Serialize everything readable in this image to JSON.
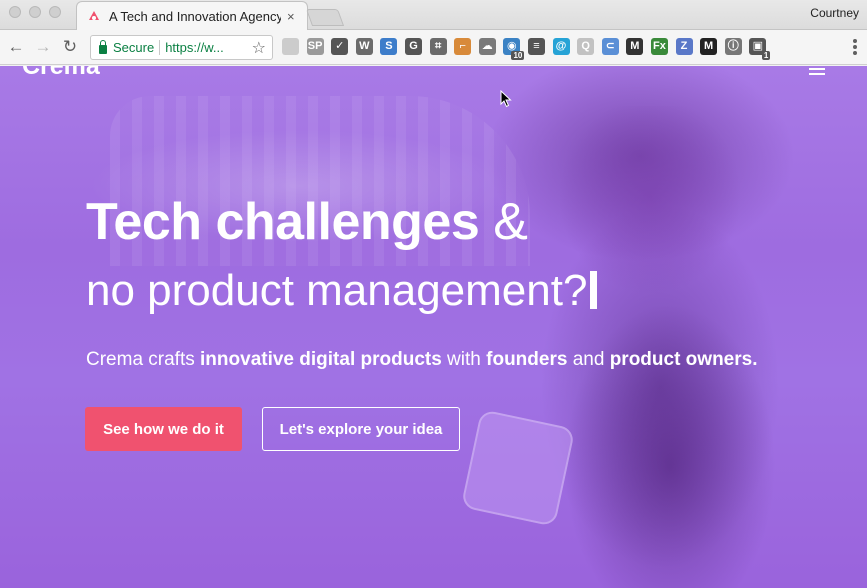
{
  "browser": {
    "tab_title": "A Tech and Innovation Agency",
    "tab_close": "×",
    "profile_name": "Courtney",
    "secure_label": "Secure",
    "url_visible": "https://w...",
    "star_icon": "☆",
    "back_icon": "←",
    "forward_icon": "→",
    "reload_icon": "↻",
    "extensions": [
      {
        "name": "hook-extension-icon",
        "glyph": "",
        "color": "#cccccc"
      },
      {
        "name": "sp-extension-icon",
        "glyph": "SP",
        "color": "#9a9a9a"
      },
      {
        "name": "checkmark-extension-icon",
        "glyph": "✓",
        "color": "#555555"
      },
      {
        "name": "wordpress-extension-icon",
        "glyph": "W",
        "color": "#6b6b6b"
      },
      {
        "name": "s-extension-icon",
        "glyph": "S",
        "color": "#3d7dca"
      },
      {
        "name": "g-extension-icon",
        "glyph": "G",
        "color": "#555555"
      },
      {
        "name": "crop-extension-icon",
        "glyph": "⌗",
        "color": "#6b6b6b"
      },
      {
        "name": "ruler-extension-icon",
        "glyph": "⌐",
        "color": "#d88a3a"
      },
      {
        "name": "cloud-extension-icon",
        "glyph": "☁",
        "color": "#7a7a7a"
      },
      {
        "name": "notification-extension-icon",
        "glyph": "◉",
        "color": "#3b82c4",
        "badge": "10"
      },
      {
        "name": "list-extension-icon",
        "glyph": "≡",
        "color": "#555555"
      },
      {
        "name": "at-extension-icon",
        "glyph": "@",
        "color": "#26a3d6"
      },
      {
        "name": "search-extension-icon",
        "glyph": "Q",
        "color": "#c2c2c2"
      },
      {
        "name": "rss-extension-icon",
        "glyph": "⊂",
        "color": "#5a8fd6"
      },
      {
        "name": "medium-extension-icon",
        "glyph": "M",
        "color": "#333333"
      },
      {
        "name": "fx-extension-icon",
        "glyph": "Fx",
        "color": "#3a8a3a"
      },
      {
        "name": "z-extension-icon",
        "glyph": "Z",
        "color": "#5a78c8"
      },
      {
        "name": "m-extension-icon",
        "glyph": "M",
        "color": "#222222"
      },
      {
        "name": "info-extension-icon",
        "glyph": "ⓘ",
        "color": "#777777"
      },
      {
        "name": "camera-extension-icon",
        "glyph": "▣",
        "color": "#555555",
        "badge": "1"
      }
    ]
  },
  "site": {
    "logo": "Crema",
    "headline_bold": "Tech challenges",
    "headline_amp": " &",
    "headline_line2": "no product management?",
    "tagline_1": "Crema crafts ",
    "tagline_2": "innovative digital products",
    "tagline_3": " with ",
    "tagline_4": "founders",
    "tagline_5": " and ",
    "tagline_6": "product owners.",
    "cta_primary": "See how we do it",
    "cta_secondary": "Let's explore your idea"
  },
  "colors": {
    "hero_purple": "#9e6ce0",
    "cta_pink": "#f0526f",
    "secure_green": "#0b8043"
  }
}
